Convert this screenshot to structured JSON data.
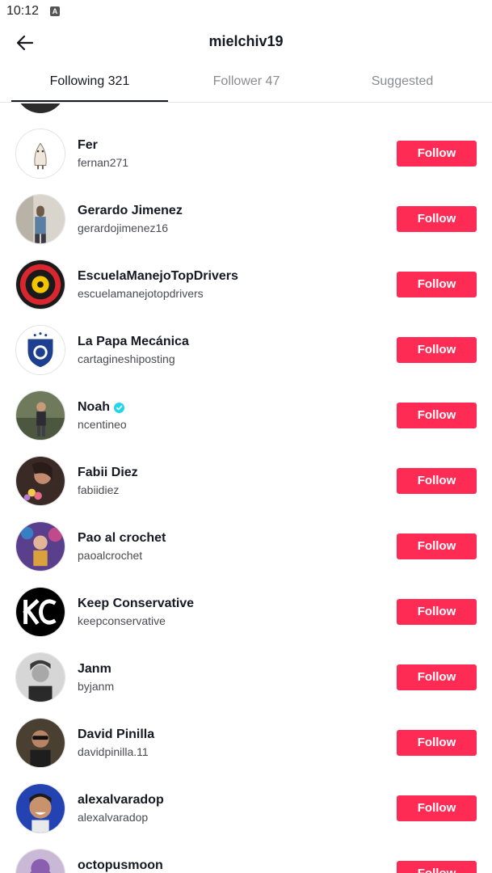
{
  "status": {
    "time": "10:12",
    "notification_icon": "A"
  },
  "header": {
    "title": "mielchiv19",
    "back_icon": "arrow-left-icon"
  },
  "tabs": [
    {
      "label": "Following 321",
      "active": true
    },
    {
      "label": "Follower 47",
      "active": false
    },
    {
      "label": "Suggested",
      "active": false
    }
  ],
  "colors": {
    "accent": "#fe2c55",
    "verified": "#20d5ec"
  },
  "users": [
    {
      "name": "Fer",
      "username": "fernan271",
      "button": "Follow",
      "verified": false
    },
    {
      "name": "Gerardo Jimenez",
      "username": "gerardojimenez16",
      "button": "Follow",
      "verified": false
    },
    {
      "name": "EscuelaManejoTopDrivers",
      "username": "escuelamanejotopdrivers",
      "button": "Follow",
      "verified": false
    },
    {
      "name": "La Papa Mecánica",
      "username": "cartagineshiposting",
      "button": "Follow",
      "verified": false
    },
    {
      "name": "Noah",
      "username": "ncentineo",
      "button": "Follow",
      "verified": true
    },
    {
      "name": "Fabii Diez",
      "username": "fabiidiez",
      "button": "Follow",
      "verified": false
    },
    {
      "name": "Pao al crochet",
      "username": "paoalcrochet",
      "button": "Follow",
      "verified": false
    },
    {
      "name": "Keep Conservative",
      "username": "keepconservative",
      "button": "Follow",
      "verified": false
    },
    {
      "name": "Janm",
      "username": "byjanm",
      "button": "Follow",
      "verified": false
    },
    {
      "name": "David Pinilla",
      "username": "davidpinilla.11",
      "button": "Follow",
      "verified": false
    },
    {
      "name": "alexalvaradop",
      "username": "alexalvaradop",
      "button": "Follow",
      "verified": false
    },
    {
      "name": "octopusmoon",
      "username": "",
      "button": "Follow",
      "verified": false
    }
  ]
}
